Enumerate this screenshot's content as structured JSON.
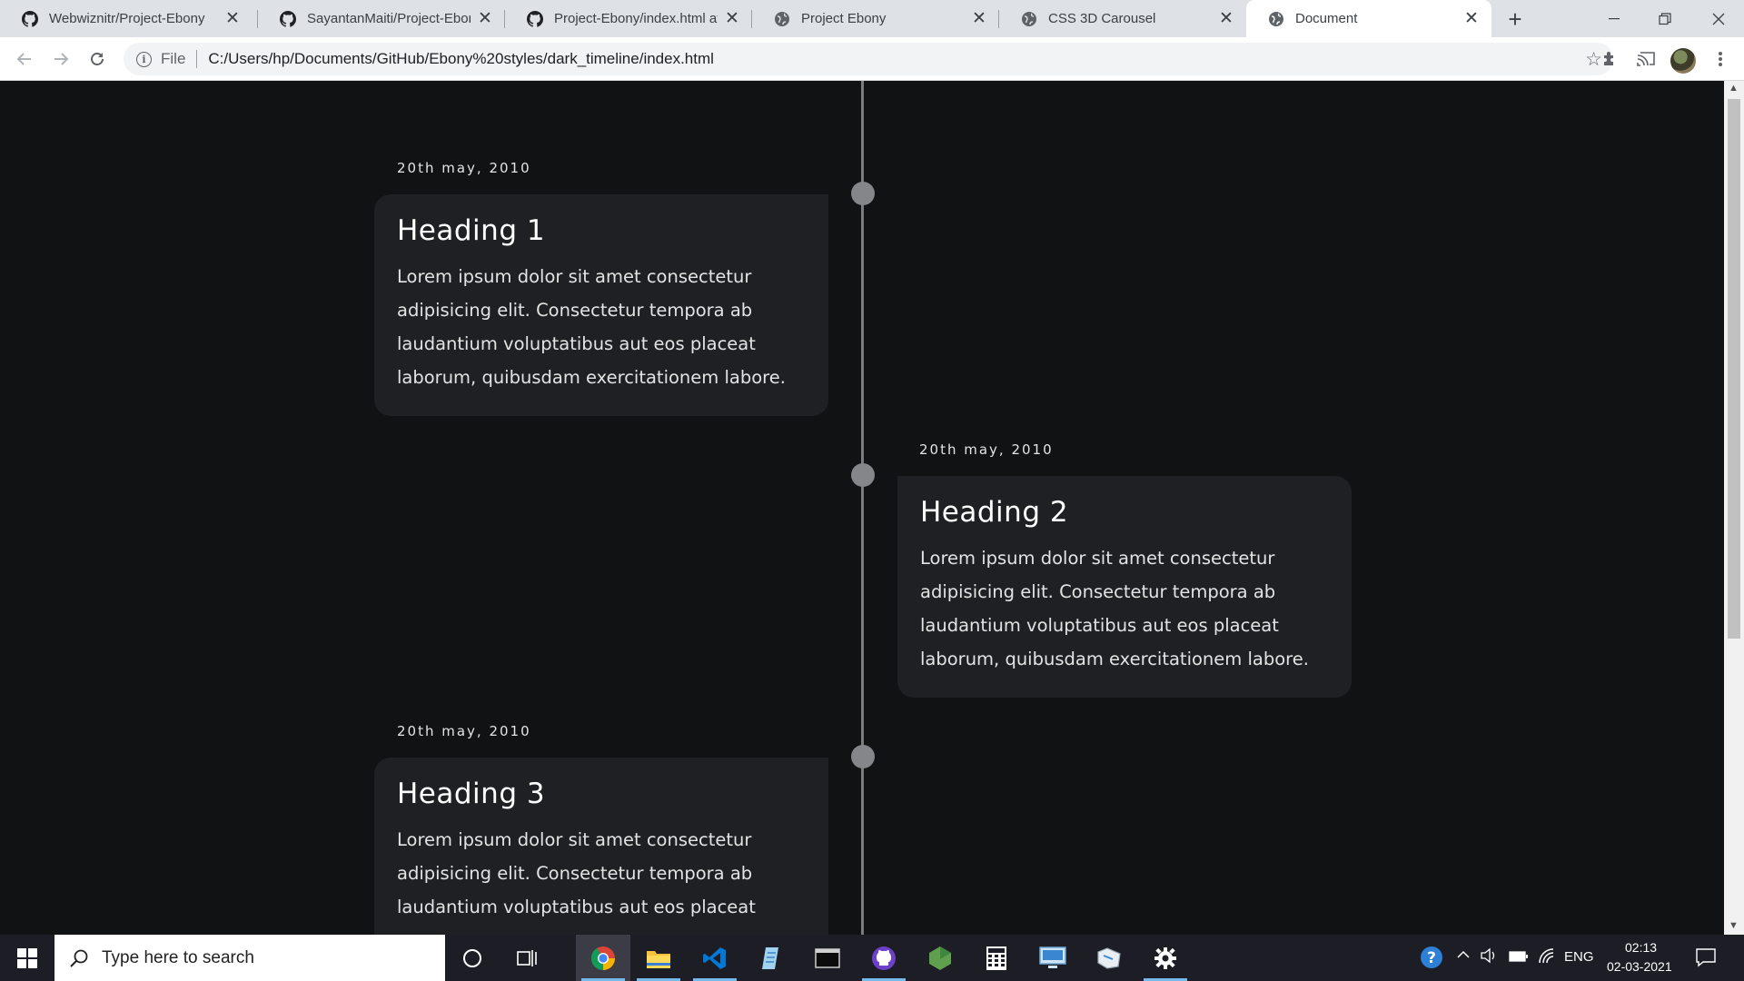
{
  "browser": {
    "tabs": [
      {
        "title": "Webwiznitr/Project-Ebony",
        "favicon": "github-icon",
        "active": false
      },
      {
        "title": "SayantanMaiti/Project-Ebony",
        "favicon": "github-icon",
        "active": false
      },
      {
        "title": "Project-Ebony/index.html at",
        "favicon": "github-icon",
        "active": false
      },
      {
        "title": "Project Ebony",
        "favicon": "globe-icon",
        "active": false
      },
      {
        "title": "CSS 3D Carousel",
        "favicon": "globe-icon",
        "active": false
      },
      {
        "title": "Document",
        "favicon": "globe-icon",
        "active": true
      }
    ],
    "address": {
      "scheme_label": "File",
      "url": "C:/Users/hp/Documents/GitHub/Ebony%20styles/dark_timeline/index.html"
    }
  },
  "timeline": {
    "items": [
      {
        "date": "20th may, 2010",
        "heading": "Heading 1",
        "text": "Lorem ipsum dolor sit amet consectetur adipisicing elit. Consectetur tempora ab laudantium voluptatibus aut eos placeat laborum, quibusdam exercitationem labore.",
        "side": "left"
      },
      {
        "date": "20th may, 2010",
        "heading": "Heading 2",
        "text": "Lorem ipsum dolor sit amet consectetur adipisicing elit. Consectetur tempora ab laudantium voluptatibus aut eos placeat laborum, quibusdam exercitationem labore.",
        "side": "right"
      },
      {
        "date": "20th may, 2010",
        "heading": "Heading 3",
        "text": "Lorem ipsum dolor sit amet consectetur adipisicing elit. Consectetur tempora ab laudantium voluptatibus aut eos placeat",
        "side": "left"
      }
    ],
    "colors": {
      "background": "#111213",
      "card": "#1f2023",
      "line": "#7b7c7e",
      "dot": "#85868a"
    }
  },
  "taskbar": {
    "search_placeholder": "Type here to search",
    "apps": [
      "cortana-icon",
      "task-view-icon",
      "chrome-icon",
      "file-explorer-icon",
      "vscode-icon",
      "notepad-icon",
      "terminal-icon",
      "github-desktop-icon",
      "nodejs-icon",
      "calculator-icon",
      "remote-desktop-icon",
      "paint-icon",
      "settings-icon"
    ],
    "tray": {
      "language": "ENG",
      "time": "02:13",
      "date": "02-03-2021"
    }
  }
}
